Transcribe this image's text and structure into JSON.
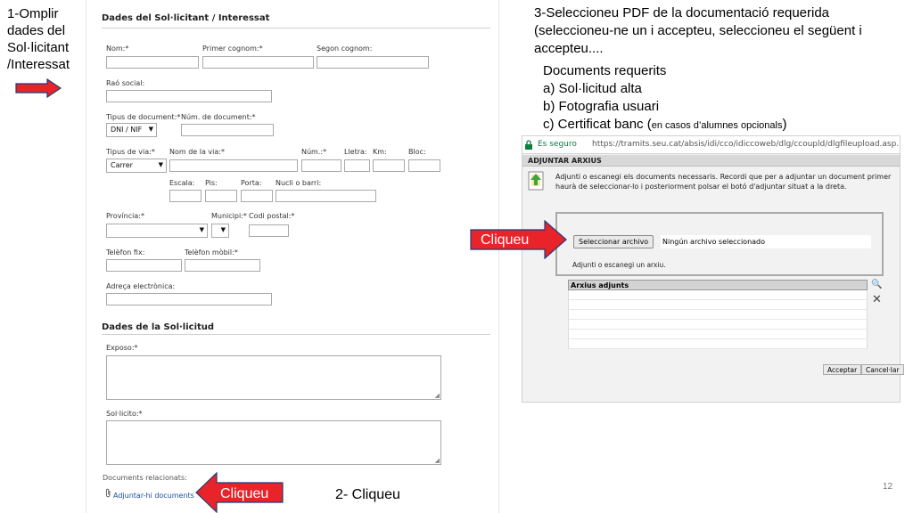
{
  "step1": {
    "lines": [
      "1-Omplir",
      "dades del",
      "Sol·licitant",
      "/Interessat"
    ]
  },
  "form": {
    "section1_title": "Dades del Sol·licitant / Interessat",
    "labels": {
      "nom": "Nom:*",
      "primer_cognom": "Primer cognom:*",
      "segon_cognom": "Segon cognom:",
      "rao_social": "Raó social:",
      "tipus_document": "Tipus de document:*",
      "num_document": "Núm. de document:*",
      "tipus_via": "Tipus de via:*",
      "nom_via": "Nom de la via:*",
      "num": "Núm.:*",
      "lletra": "Lletra:",
      "km": "Km:",
      "bloc": "Bloc:",
      "escala": "Escala:",
      "pis": "Pis:",
      "porta": "Porta:",
      "nucli": "Nucli o barri:",
      "provincia": "Província:*",
      "municipi": "Municipi:*",
      "codi_postal": "Codi postal:*",
      "telefon_fix": "Telèfon fix:",
      "telefon_mobil": "Telèfon mòbil:*",
      "adreca_electronica": "Adreça electrònica:"
    },
    "selects": {
      "tipus_document": "DNI / NIF",
      "tipus_via": "Carrer"
    },
    "section2_title": "Dades de la Sol·licitud",
    "labels2": {
      "exposo": "Exposo:*",
      "sollicito": "Sol·licito:*",
      "documents_relacionats": "Documents relacionats:"
    },
    "link_adjuntar": "Adjuntar-hi documents"
  },
  "cliqueu_label": "Cliqueu",
  "step2": "2- Cliqueu",
  "step3": {
    "text": "3-Seleccioneu PDF de la documentació requerida (seleccioneu-ne un i accepteu, seleccioneu el següent i accepteu...."
  },
  "docs": {
    "title": "Documents requerits",
    "a": "a) Sol·licitud alta",
    "b": "b) Fotografia usuari",
    "c_main": "c) Certificat banc (",
    "c_small": "en casos d’alumnes opcionals",
    "c_close": ")"
  },
  "browser": {
    "secure_label": "Es seguro",
    "url": "https://tramits.seu.cat/absis/idi/cco/idiccoweb/dlg/ccoupld/dlgfileupload.asp...",
    "dialog_title": "ADJUNTAR ARXIUS",
    "message": "Adjunti o escanegi els documents necessaris. Recordi que per a adjuntar un document primer haurà de seleccionar-lo i posteriorment polsar el botó d'adjuntar situat a la dreta.",
    "file_button": "Seleccionar archivo",
    "file_status": "Ningún archivo seleccionado",
    "upload_note": "Adjunti o escanegi un arxiu.",
    "table_header": "Arxius adjunts",
    "accept": "Acceptar",
    "cancel": "Cancel·lar"
  },
  "page_number": "12",
  "colors": {
    "arrow": "#e8232a",
    "secure": "#0b8043",
    "link": "#1a4c9e"
  }
}
